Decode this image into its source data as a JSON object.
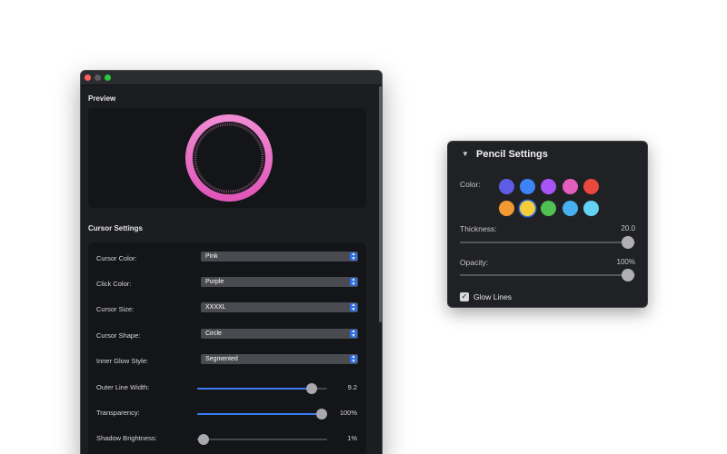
{
  "main_window": {
    "preview_title": "Preview",
    "settings_title": "Cursor Settings",
    "preview_ring": {
      "color": "#e86fc3",
      "inner_glow": "segmented"
    },
    "rows": [
      {
        "type": "select",
        "label": "Cursor Color:",
        "value": "Pink"
      },
      {
        "type": "select",
        "label": "Click Color:",
        "value": "Purple"
      },
      {
        "type": "select",
        "label": "Cursor Size:",
        "value": "XXXXL"
      },
      {
        "type": "select",
        "label": "Cursor Shape:",
        "value": "Circle"
      },
      {
        "type": "select",
        "label": "Inner Glow Style:",
        "value": "Segmented"
      },
      {
        "type": "slider",
        "label": "Outer Line Width:",
        "value": "9.2",
        "fraction": 0.88
      },
      {
        "type": "slider",
        "label": "Transparency:",
        "value": "100%",
        "fraction": 0.96
      },
      {
        "type": "slider",
        "label": "Shadow Brightness:",
        "value": "1%",
        "fraction": 0.05
      }
    ]
  },
  "pencil_panel": {
    "title": "Pencil Settings",
    "color_label": "Color:",
    "swatches": [
      {
        "color": "#5e5ce6",
        "selected": false
      },
      {
        "color": "#3d82f6",
        "selected": false
      },
      {
        "color": "#a855f7",
        "selected": false
      },
      {
        "color": "#e25fc0",
        "selected": false
      },
      {
        "color": "#e8483e",
        "selected": false
      },
      {
        "color": "#f29a32",
        "selected": false
      },
      {
        "color": "#f5cd3a",
        "selected": true
      },
      {
        "color": "#4fc153",
        "selected": false
      },
      {
        "color": "#48b0f0",
        "selected": false
      },
      {
        "color": "#64d2f5",
        "selected": false
      }
    ],
    "thickness_label": "Thickness:",
    "thickness_value": "20.0",
    "thickness_fraction": 0.96,
    "opacity_label": "Opacity:",
    "opacity_value": "100%",
    "opacity_fraction": 0.96,
    "glow_label": "Glow Lines",
    "glow_checked": true
  }
}
